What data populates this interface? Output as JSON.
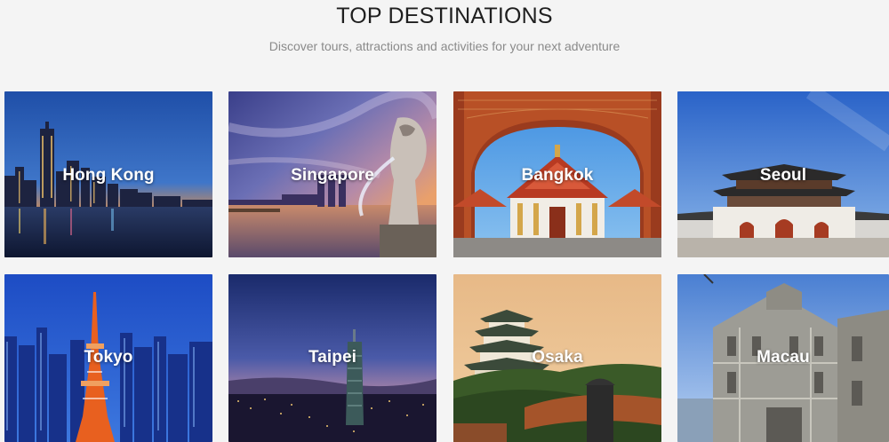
{
  "header": {
    "title": "TOP DESTINATIONS",
    "subtitle": "Discover tours, attractions and activities for your next adventure"
  },
  "destinations": [
    {
      "name": "Hong Kong"
    },
    {
      "name": "Singapore"
    },
    {
      "name": "Bangkok"
    },
    {
      "name": "Seoul"
    },
    {
      "name": "Tokyo"
    },
    {
      "name": "Taipei"
    },
    {
      "name": "Osaka"
    },
    {
      "name": "Macau"
    }
  ],
  "colors": {
    "background": "#f4f4f4",
    "title": "#1f1f1f",
    "subtitle": "#8a8a8a",
    "card_label": "#ffffff"
  }
}
